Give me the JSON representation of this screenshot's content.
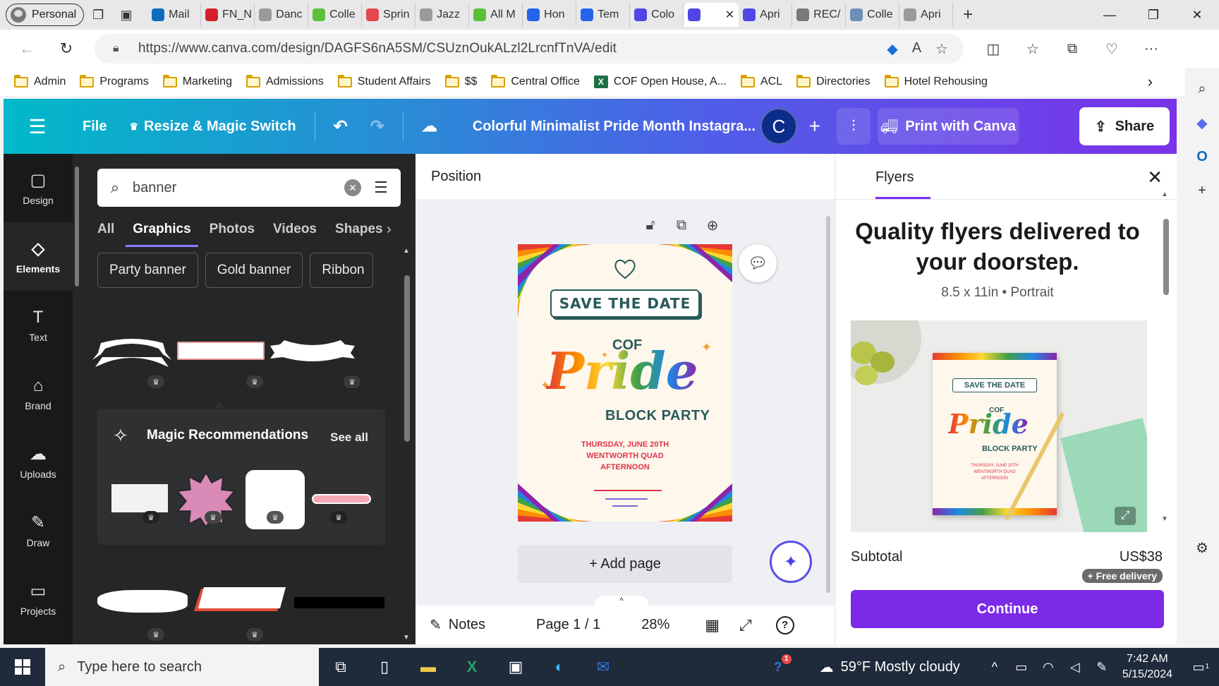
{
  "browser": {
    "profile": "Personal",
    "tabs": [
      {
        "label": "Mail",
        "color": "#0f6cbd"
      },
      {
        "label": "FN_N",
        "color": "#d61f2c"
      },
      {
        "label": "Danc",
        "color": "#9a9a9a"
      },
      {
        "label": "Colle",
        "color": "#5bbf3a"
      },
      {
        "label": "Sprin",
        "color": "#e5484d"
      },
      {
        "label": "Jazz",
        "color": "#9a9a9a"
      },
      {
        "label": "All M",
        "color": "#5bbf3a"
      },
      {
        "label": "Hon",
        "color": "#2563eb"
      },
      {
        "label": "Tem",
        "color": "#2563eb"
      },
      {
        "label": "Colo",
        "color": "#4f46e5"
      },
      {
        "label": "",
        "color": "#4f46e5",
        "active": true
      },
      {
        "label": "Apri",
        "color": "#4f46e5"
      },
      {
        "label": "REC/",
        "color": "#7a7a7a"
      },
      {
        "label": "Colle",
        "color": "#6b8fb5"
      },
      {
        "label": "Apri",
        "color": "#9a9a9a"
      }
    ],
    "url": "https://www.canva.com/design/DAGFS6nA5SM/CSUznOukALzl2LrcnfTnVA/edit",
    "bookmarks": [
      {
        "label": "Admin",
        "type": "folder"
      },
      {
        "label": "Programs",
        "type": "folder"
      },
      {
        "label": "Marketing",
        "type": "folder"
      },
      {
        "label": "Admissions",
        "type": "folder"
      },
      {
        "label": "Student Affairs",
        "type": "folder"
      },
      {
        "label": "$$",
        "type": "folder"
      },
      {
        "label": "Central Office",
        "type": "folder"
      },
      {
        "label": "COF Open House, A...",
        "type": "excel"
      },
      {
        "label": "ACL",
        "type": "folder"
      },
      {
        "label": "Directories",
        "type": "folder"
      },
      {
        "label": "Hotel Rehousing",
        "type": "folder"
      }
    ]
  },
  "header": {
    "file": "File",
    "resize": "Resize & Magic Switch",
    "title": "Colorful Minimalist Pride Month Instagra...",
    "avatar_letter": "C",
    "print": "Print with Canva",
    "share": "Share"
  },
  "rail": [
    {
      "label": "Design",
      "icon": "design-icon",
      "glyph": "▢"
    },
    {
      "label": "Elements",
      "icon": "elements-icon",
      "glyph": "◇",
      "active": true
    },
    {
      "label": "Text",
      "icon": "text-icon",
      "glyph": "T"
    },
    {
      "label": "Brand",
      "icon": "brand-icon",
      "glyph": "⌂"
    },
    {
      "label": "Uploads",
      "icon": "uploads-icon",
      "glyph": "☁"
    },
    {
      "label": "Draw",
      "icon": "draw-icon",
      "glyph": "✎"
    },
    {
      "label": "Projects",
      "icon": "projects-icon",
      "glyph": "▭"
    }
  ],
  "panel": {
    "search_value": "banner",
    "tabs": [
      "All",
      "Graphics",
      "Photos",
      "Videos",
      "Shapes"
    ],
    "active_tab": "Graphics",
    "chips": [
      "Party banner",
      "Gold banner",
      "Ribbon"
    ],
    "magic_title": "Magic Recommendations",
    "see_all": "See all"
  },
  "canvas": {
    "position_label": "Position",
    "add_page": "+ Add page",
    "notes": "Notes",
    "page_indicator": "Page 1 / 1",
    "zoom": "28%"
  },
  "design": {
    "save_the_date": "SAVE THE DATE",
    "org": "COF",
    "pride": "Pride",
    "block_party": "BLOCK PARTY",
    "details": [
      "THURSDAY, JUNE 20TH",
      "WENTWORTH QUAD",
      "AFTERNOON"
    ]
  },
  "flyers": {
    "tab": "Flyers",
    "headline": "Quality flyers delivered to your doorstep.",
    "spec": "8.5 x 11in • Portrait",
    "subtotal_label": "Subtotal",
    "price": "US$38",
    "delivery_badge": "+ Free delivery",
    "continue": "Continue"
  },
  "taskbar": {
    "search_placeholder": "Type here to search",
    "weather": "59°F  Mostly cloudy",
    "time": "7:42 AM",
    "date": "5/15/2024",
    "notification_count": "1",
    "teams_badge": "1"
  },
  "colors": {
    "accent_purple": "#7d2ae8",
    "canva_teal": "#01b9c9",
    "rainbow": [
      "#e53935",
      "#fb8c00",
      "#fdd835",
      "#43a047",
      "#1e88e5",
      "#8e24aa"
    ]
  }
}
